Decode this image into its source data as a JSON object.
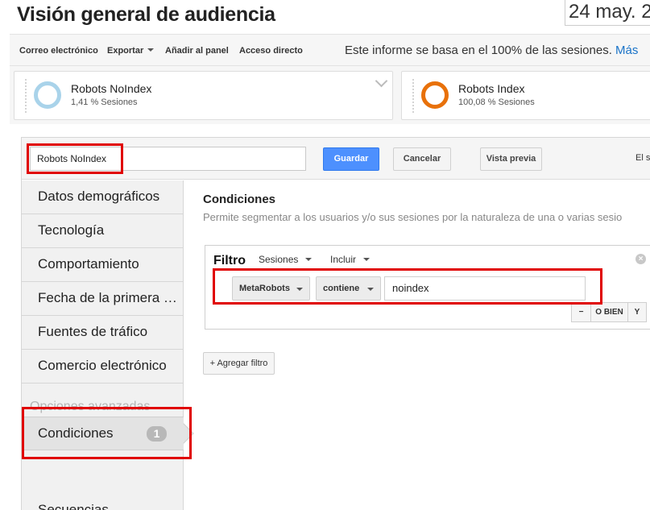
{
  "header": {
    "title": "Visión general de audiencia",
    "date": "24 may. 2"
  },
  "toolbar": {
    "email": "Correo electrónico",
    "export": "Exportar",
    "add_to_panel": "Añadir al panel",
    "shortcut": "Acceso directo",
    "info": "Este informe se basa en el 100% de las sesiones.",
    "more": "Más"
  },
  "segments": [
    {
      "name": "Robots NoIndex",
      "stat": "1,41 % Sesiones",
      "color": "#a9d3ea"
    },
    {
      "name": "Robots Index",
      "stat": "100,08 % Sesiones",
      "color": "#e8710a"
    }
  ],
  "editor": {
    "segment_name": "Robots NoIndex",
    "save": "Guardar",
    "cancel": "Cancelar",
    "preview": "Vista previa",
    "header_cut": "El s"
  },
  "sidebar": {
    "items": [
      "Datos demográficos",
      "Tecnología",
      "Comportamiento",
      "Fecha de la primera visita",
      "Fuentes de tráfico",
      "Comercio electrónico"
    ],
    "advanced_label": "Opciones avanzadas",
    "active": {
      "label": "Condiciones",
      "count": "1"
    },
    "sequences": "Secuencias"
  },
  "conditions": {
    "title": "Condiciones",
    "description": "Permite segmentar a los usuarios y/o sus sesiones por la naturaleza de una o varias sesio",
    "filter": {
      "label": "Filtro",
      "scope": "Sesiones",
      "mode": "Incluir",
      "close": "×",
      "dimension": "MetaRobots",
      "operator": "contiene",
      "value": "noindex",
      "remove": "−",
      "or": "O BIEN",
      "and": "Y"
    },
    "add_filter": "+ Agregar filtro"
  }
}
